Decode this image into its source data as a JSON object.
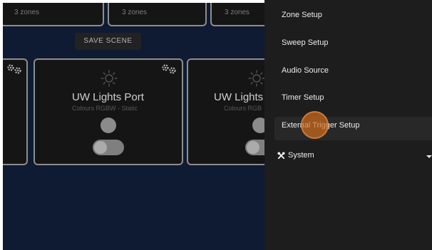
{
  "scenes": {
    "top_cards": [
      {
        "zones": "3 zones"
      },
      {
        "zones": "3 zones"
      },
      {
        "zones": "3 zones"
      }
    ],
    "save_scene_label": "SAVE SCENE"
  },
  "light_cards": [
    {
      "name": "UW Lights Port",
      "subtitle": "Colours RGBW - Static",
      "light_on": false
    },
    {
      "name": "UW Lights S",
      "subtitle": "Colours RGB",
      "light_on": false
    }
  ],
  "menu": {
    "items": [
      {
        "label": "Zone Setup"
      },
      {
        "label": "Sweep Setup"
      },
      {
        "label": "Audio Source"
      },
      {
        "label": "Timer Setup"
      },
      {
        "label": "External Trigger Setup"
      }
    ],
    "system": {
      "label": "System",
      "icon": "tools-icon"
    }
  },
  "colors": {
    "background": "#0e1b33",
    "card": "#151515",
    "menu": "#1d1d1d",
    "touch_indicator": "#d66e1c"
  }
}
